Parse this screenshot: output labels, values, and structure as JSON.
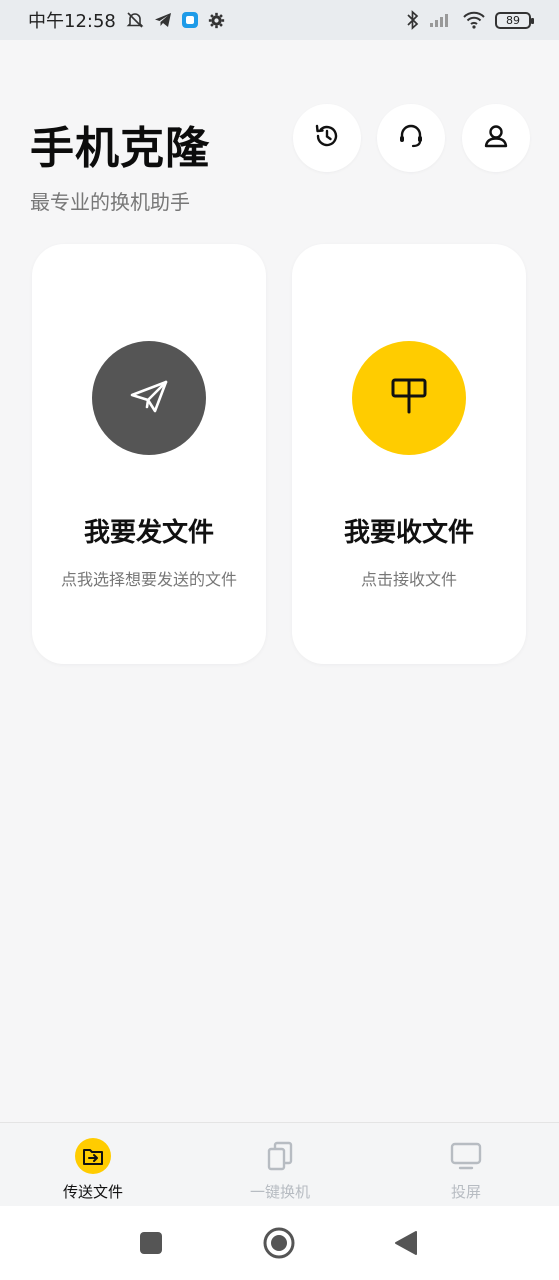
{
  "status_bar": {
    "time": "中午12:58",
    "battery": "89",
    "icons": [
      "mute-bell-icon",
      "telegram-icon",
      "app-icon",
      "settings-gear-icon",
      "bluetooth-icon",
      "signal-icon",
      "wifi-icon",
      "battery-icon"
    ]
  },
  "header": {
    "title": "手机克隆",
    "subtitle": "最专业的换机助手",
    "actions": [
      "history-icon",
      "customer-service-icon",
      "user-icon"
    ]
  },
  "colors": {
    "send_circle": "#555555",
    "receive_circle": "#ffcc00",
    "accent": "#ffcc00",
    "tab_inactive": "#b7bcc2"
  },
  "cards": {
    "send": {
      "title": "我要发文件",
      "subtitle": "点我选择想要发送的文件",
      "icon": "paper-plane-icon"
    },
    "receive": {
      "title": "我要收文件",
      "subtitle": "点击接收文件",
      "icon": "mailbox-icon"
    }
  },
  "tabs": [
    {
      "label": "传送文件",
      "icon": "folder-transfer-icon",
      "active": true
    },
    {
      "label": "一键换机",
      "icon": "copy-phone-icon",
      "active": false
    },
    {
      "label": "投屏",
      "icon": "screen-cast-icon",
      "active": false
    }
  ],
  "nav": [
    "recents-square-icon",
    "home-circle-icon",
    "back-triangle-icon"
  ]
}
